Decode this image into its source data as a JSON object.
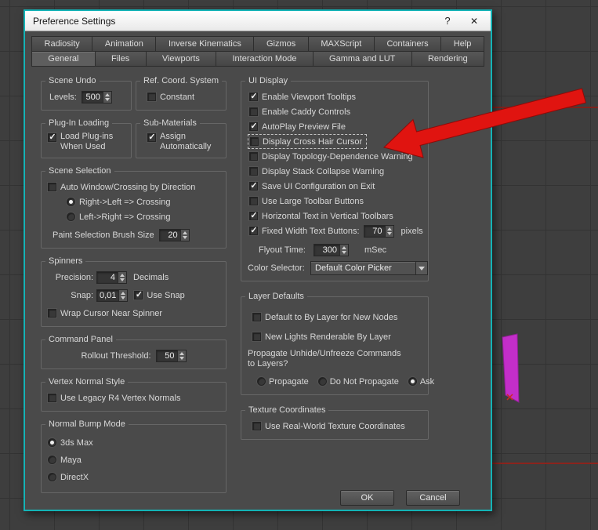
{
  "window": {
    "title": "Preference Settings",
    "help": "?",
    "close": "✕"
  },
  "tabs_row1": [
    "Radiosity",
    "Animation",
    "Inverse Kinematics",
    "Gizmos",
    "MAXScript",
    "Containers",
    "Help"
  ],
  "tabs_row2": [
    "General",
    "Files",
    "Viewports",
    "Interaction Mode",
    "Gamma and LUT",
    "Rendering"
  ],
  "scene_undo": {
    "title": "Scene Undo",
    "levels_label": "Levels:",
    "levels_value": "500"
  },
  "ref_coord": {
    "title": "Ref. Coord. System",
    "constant": {
      "label": "Constant",
      "checked": false
    }
  },
  "plugin_loading": {
    "title": "Plug-In Loading",
    "load": {
      "label": "Load Plug-ins When Used",
      "checked": true
    }
  },
  "sub_materials": {
    "title": "Sub-Materials",
    "assign": {
      "label": "Assign Automatically",
      "checked": true
    }
  },
  "scene_selection": {
    "title": "Scene Selection",
    "auto_window": {
      "label": "Auto Window/Crossing by Direction",
      "checked": false
    },
    "radio_rl": {
      "label": "Right->Left => Crossing",
      "checked": true
    },
    "radio_lr": {
      "label": "Left->Right => Crossing",
      "checked": false
    },
    "brush_label": "Paint Selection Brush Size",
    "brush_value": "20"
  },
  "spinners_group": {
    "title": "Spinners",
    "precision_label": "Precision:",
    "precision_value": "4",
    "decimals_label": "Decimals",
    "snap_label": "Snap:",
    "snap_value": "0,01",
    "use_snap": {
      "label": "Use Snap",
      "checked": true
    },
    "wrap": {
      "label": "Wrap Cursor Near Spinner",
      "checked": false
    }
  },
  "command_panel": {
    "title": "Command Panel",
    "rollout_label": "Rollout Threshold:",
    "rollout_value": "50"
  },
  "vertex_normal": {
    "title": "Vertex Normal Style",
    "legacy": {
      "label": "Use Legacy R4 Vertex Normals",
      "checked": false
    }
  },
  "normal_bump": {
    "title": "Normal Bump Mode",
    "options": [
      {
        "label": "3ds Max",
        "checked": true
      },
      {
        "label": "Maya",
        "checked": false
      },
      {
        "label": "DirectX",
        "checked": false
      }
    ]
  },
  "ui_display": {
    "title": "UI Display",
    "checks": [
      {
        "label": "Enable Viewport Tooltips",
        "checked": true
      },
      {
        "label": "Enable Caddy Controls",
        "checked": false
      },
      {
        "label": "AutoPlay Preview File",
        "checked": true
      },
      {
        "label": "Display Cross Hair Cursor",
        "checked": false
      },
      {
        "label": "Display Topology-Dependence Warning",
        "checked": false
      },
      {
        "label": "Display Stack Collapse Warning",
        "checked": false
      },
      {
        "label": "Save UI Configuration on Exit",
        "checked": true
      },
      {
        "label": "Use Large Toolbar Buttons",
        "checked": false
      },
      {
        "label": "Horizontal Text in Vertical Toolbars",
        "checked": true
      }
    ],
    "fixed_width": {
      "label": "Fixed Width Text Buttons:",
      "checked": true,
      "value": "70",
      "unit": "pixels"
    },
    "flyout_label": "Flyout Time:",
    "flyout_value": "300",
    "flyout_unit": "mSec",
    "color_label": "Color Selector:",
    "color_value": "Default Color Picker"
  },
  "layer_defaults": {
    "title": "Layer Defaults",
    "by_layer": {
      "label": "Default to By Layer for New Nodes",
      "checked": false
    },
    "new_lights": {
      "label": "New Lights Renderable By Layer",
      "checked": false
    },
    "propagate_text": "Propagate Unhide/Unfreeze Commands to Layers?",
    "options": [
      {
        "label": "Propagate",
        "checked": false
      },
      {
        "label": "Do Not Propagate",
        "checked": false
      },
      {
        "label": "Ask",
        "checked": true
      }
    ]
  },
  "texture_coords": {
    "title": "Texture Coordinates",
    "real_world": {
      "label": "Use Real-World Texture Coordinates",
      "checked": false
    }
  },
  "buttons": {
    "ok": "OK",
    "cancel": "Cancel"
  },
  "colors": {
    "accent_teal": "#14b3b6",
    "annotation_red": "#e01410",
    "shape_magenta": "#c32ec9"
  }
}
